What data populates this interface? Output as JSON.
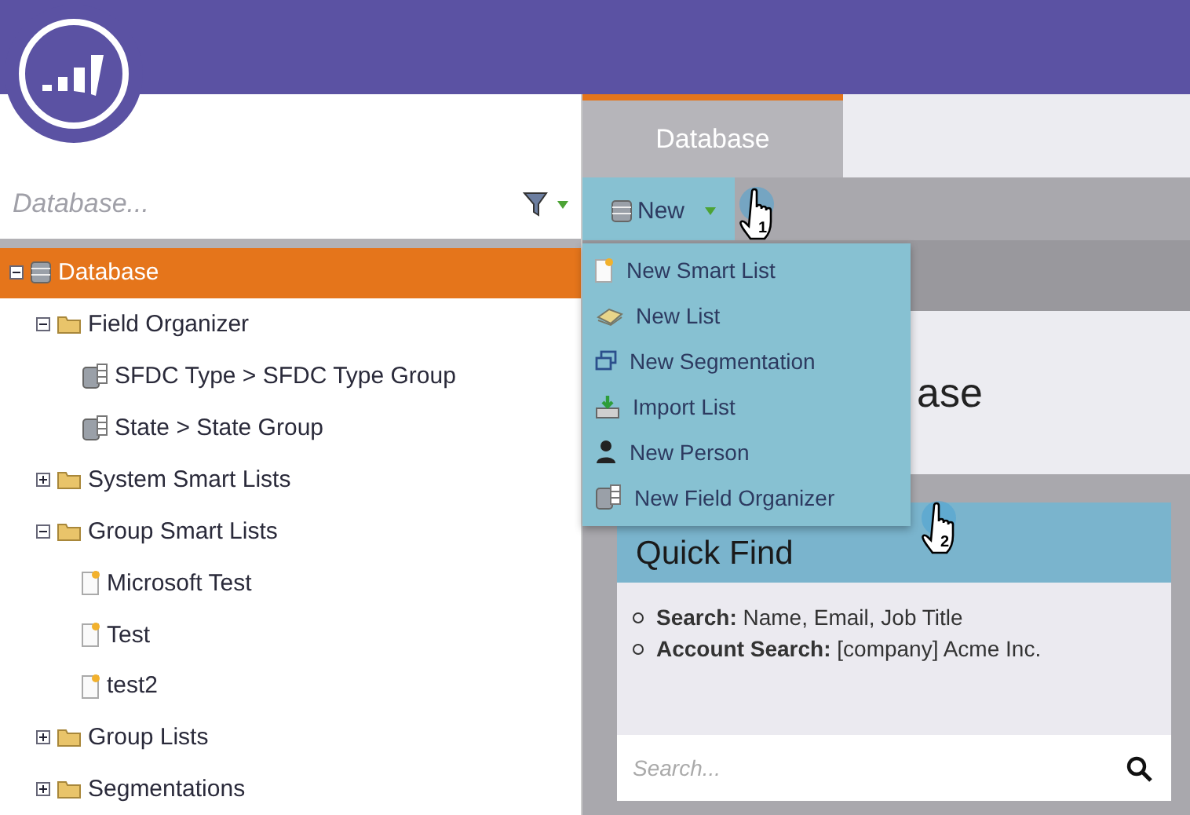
{
  "sidebar": {
    "search": {
      "placeholder": "Database..."
    },
    "tree": [
      {
        "label": "Database",
        "kind": "database",
        "selected": true,
        "expanded": true,
        "children": [
          {
            "label": "Field Organizer",
            "kind": "folder",
            "selected": false,
            "expanded": true,
            "children": [
              {
                "label": "SFDC Type > SFDC Type Group",
                "kind": "field-group",
                "selected": false
              },
              {
                "label": "State > State Group",
                "kind": "field-group",
                "selected": false
              }
            ]
          },
          {
            "label": "System Smart Lists",
            "kind": "folder",
            "selected": false,
            "expanded": false
          },
          {
            "label": "Group Smart Lists",
            "kind": "folder",
            "selected": false,
            "expanded": true,
            "children": [
              {
                "label": "Microsoft Test",
                "kind": "smart-list",
                "selected": false
              },
              {
                "label": "Test",
                "kind": "smart-list",
                "selected": false
              },
              {
                "label": "test2",
                "kind": "smart-list",
                "selected": false
              }
            ]
          },
          {
            "label": "Group Lists",
            "kind": "folder",
            "selected": false,
            "expanded": false
          },
          {
            "label": "Segmentations",
            "kind": "folder",
            "selected": false,
            "expanded": false
          }
        ]
      }
    ]
  },
  "tabs": [
    {
      "label": "Database",
      "selected": true
    }
  ],
  "toolbar": {
    "new_button": "New"
  },
  "menu": [
    {
      "label": "New Smart List",
      "kind": "smart-list"
    },
    {
      "label": "New List",
      "kind": "list"
    },
    {
      "label": "New Segmentation",
      "kind": "segmentation"
    },
    {
      "label": "Import List",
      "kind": "import"
    },
    {
      "label": "New Person",
      "kind": "person"
    },
    {
      "label": "New Field Organizer",
      "kind": "field-group"
    }
  ],
  "heading": "ase",
  "quick_find": {
    "title": "Quick Find",
    "hints": [
      "**Search:** Name, Email, Job Title",
      "**Account Search:** [company] Acme Inc."
    ],
    "search": {
      "placeholder": "Search..."
    }
  },
  "cursors": [
    {
      "label": "1"
    },
    {
      "label": "2"
    }
  ]
}
